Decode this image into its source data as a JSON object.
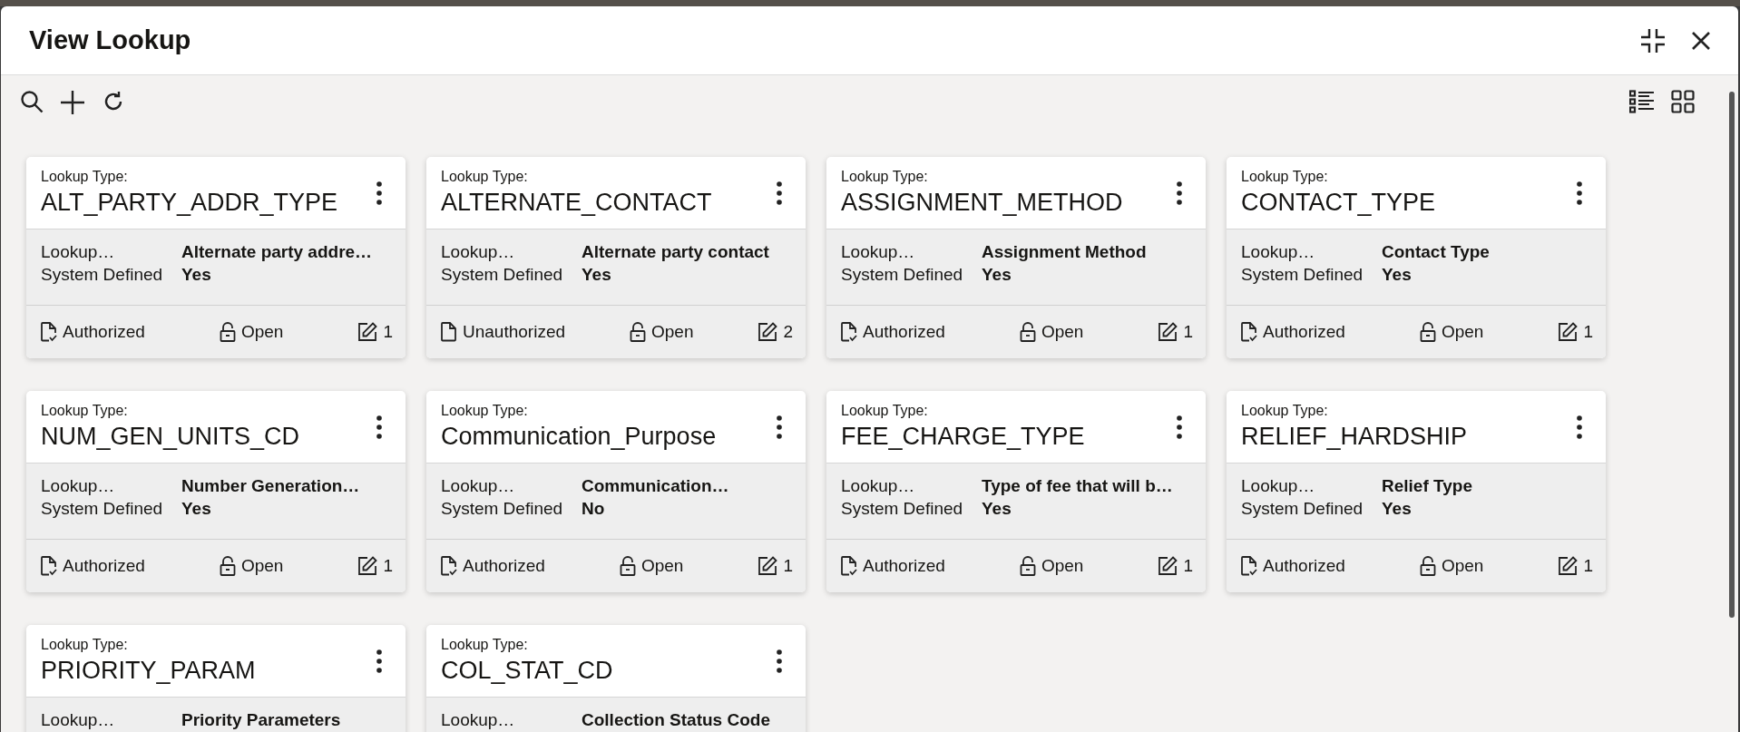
{
  "window": {
    "title": "View Lookup"
  },
  "cards": [
    {
      "label": "Lookup Type:",
      "name": "ALT_PARTY_ADDR_TYPE",
      "desc_label": "Lookup…",
      "desc": "Alternate party addre…",
      "sys_label": "System Defined",
      "sys": "Yes",
      "authorized": true,
      "status": "Authorized",
      "lock": "Open",
      "edits": "1"
    },
    {
      "label": "Lookup Type:",
      "name": "ALTERNATE_CONTACT",
      "desc_label": "Lookup…",
      "desc": "Alternate party contact",
      "sys_label": "System Defined",
      "sys": "Yes",
      "authorized": false,
      "status": "Unauthorized",
      "lock": "Open",
      "edits": "2"
    },
    {
      "label": "Lookup Type:",
      "name": "ASSIGNMENT_METHOD",
      "desc_label": "Lookup…",
      "desc": "Assignment Method",
      "sys_label": "System Defined",
      "sys": "Yes",
      "authorized": true,
      "status": "Authorized",
      "lock": "Open",
      "edits": "1"
    },
    {
      "label": "Lookup Type:",
      "name": "CONTACT_TYPE",
      "desc_label": "Lookup…",
      "desc": "Contact Type",
      "sys_label": "System Defined",
      "sys": "Yes",
      "authorized": true,
      "status": "Authorized",
      "lock": "Open",
      "edits": "1"
    },
    {
      "label": "Lookup Type:",
      "name": "NUM_GEN_UNITS_CD",
      "desc_label": "Lookup…",
      "desc": "Number Generation…",
      "sys_label": "System Defined",
      "sys": "Yes",
      "authorized": true,
      "status": "Authorized",
      "lock": "Open",
      "edits": "1"
    },
    {
      "label": "Lookup Type:",
      "name": "Communication_Purpose",
      "desc_label": "Lookup…",
      "desc": "Communication…",
      "sys_label": "System Defined",
      "sys": "No",
      "authorized": true,
      "status": "Authorized",
      "lock": "Open",
      "edits": "1"
    },
    {
      "label": "Lookup Type:",
      "name": "FEE_CHARGE_TYPE",
      "desc_label": "Lookup…",
      "desc": "Type of fee that will b…",
      "sys_label": "System Defined",
      "sys": "Yes",
      "authorized": true,
      "status": "Authorized",
      "lock": "Open",
      "edits": "1"
    },
    {
      "label": "Lookup Type:",
      "name": "RELIEF_HARDSHIP",
      "desc_label": "Lookup…",
      "desc": "Relief Type",
      "sys_label": "System Defined",
      "sys": "Yes",
      "authorized": true,
      "status": "Authorized",
      "lock": "Open",
      "edits": "1"
    },
    {
      "label": "Lookup Type:",
      "name": "PRIORITY_PARAM",
      "desc_label": "Lookup…",
      "desc": "Priority Parameters"
    },
    {
      "label": "Lookup Type:",
      "name": "COL_STAT_CD",
      "desc_label": "Lookup…",
      "desc": "Collection Status Code"
    }
  ]
}
